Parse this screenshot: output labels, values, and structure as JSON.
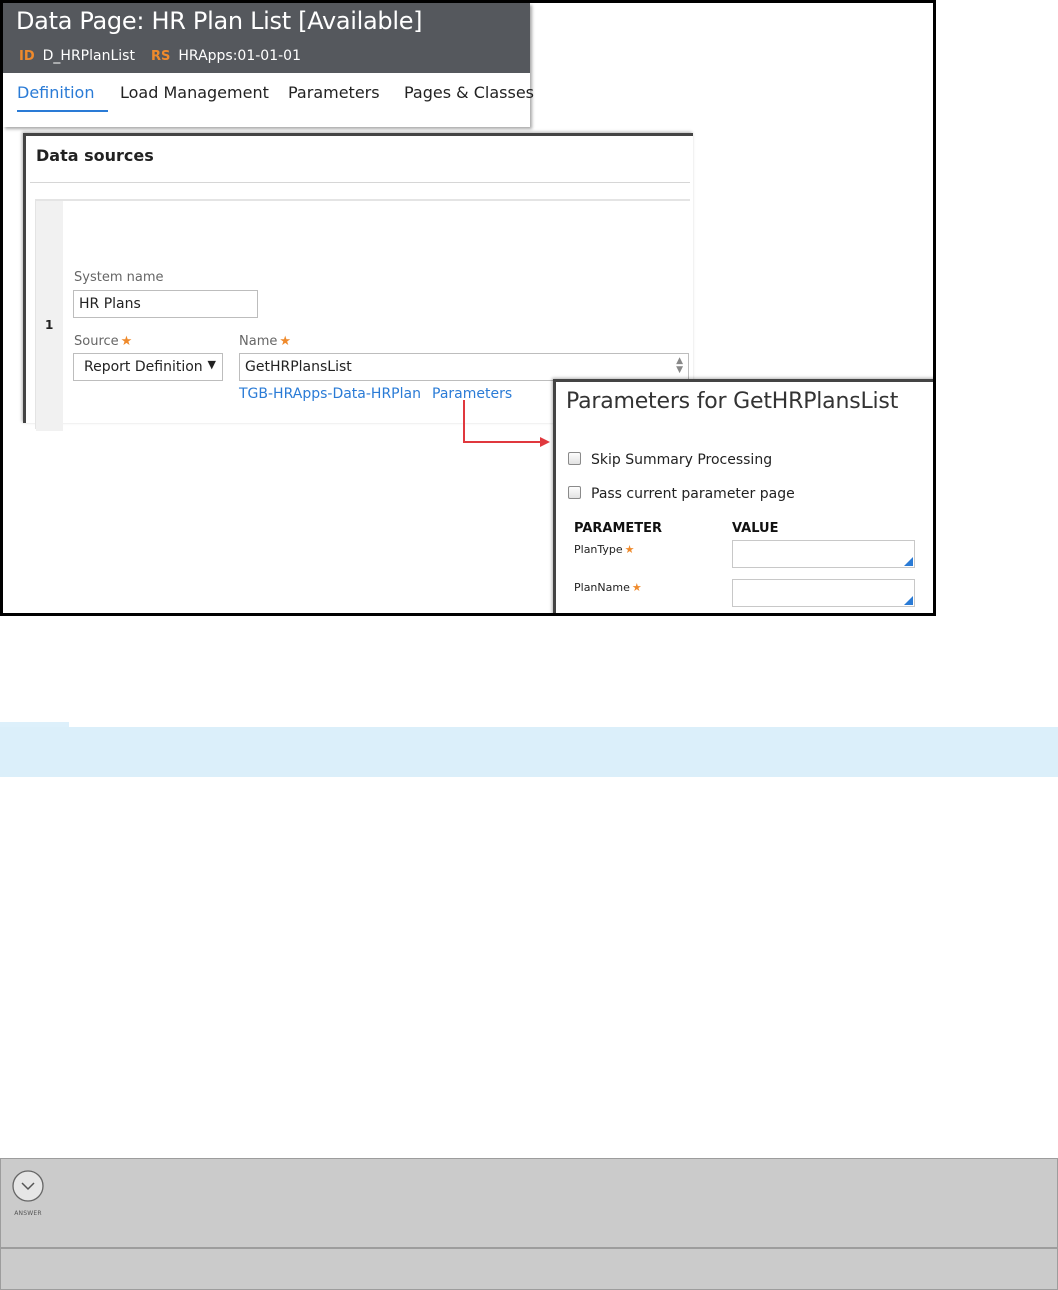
{
  "data_page": {
    "title": "Data Page: HR Plan List [Available]",
    "id_tag": "ID",
    "id_value": "D_HRPlanList",
    "rs_tag": "RS",
    "rs_value": "HRApps:01-01-01",
    "tabs": [
      {
        "label": "Definition",
        "active": true
      },
      {
        "label": "Load Management",
        "active": false
      },
      {
        "label": "Parameters",
        "active": false
      },
      {
        "label": "Pages & Classes",
        "active": false
      }
    ]
  },
  "data_sources": {
    "title": "Data sources",
    "row_number": "1",
    "system_name_label": "System name",
    "system_name_value": "HR Plans",
    "source_label": "Source",
    "source_value": "Report Definition",
    "name_label": "Name",
    "name_value": "GetHRPlansList",
    "class_link": "TGB-HRApps-Data-HRPlan",
    "parameters_link": "Parameters",
    "required_mark": "★"
  },
  "parameters_panel": {
    "title": "Parameters for GetHRPlansList",
    "checkboxes": [
      {
        "label": "Skip Summary Processing",
        "checked": false
      },
      {
        "label": "Pass current parameter page",
        "checked": false
      }
    ],
    "col_parameter": "PARAMETER",
    "col_value": "VALUE",
    "params": [
      {
        "name": "PlanType",
        "value": ""
      },
      {
        "name": "PlanName",
        "value": ""
      }
    ]
  },
  "answer": {
    "label": "ANSWER",
    "icon": "chevron-down-circle-icon"
  },
  "colors": {
    "accent": "#2a7bd6",
    "required": "#ef8a2c",
    "header_bg": "#55585d",
    "arrow": "#e0383e",
    "info_band": "#dbeffa"
  }
}
